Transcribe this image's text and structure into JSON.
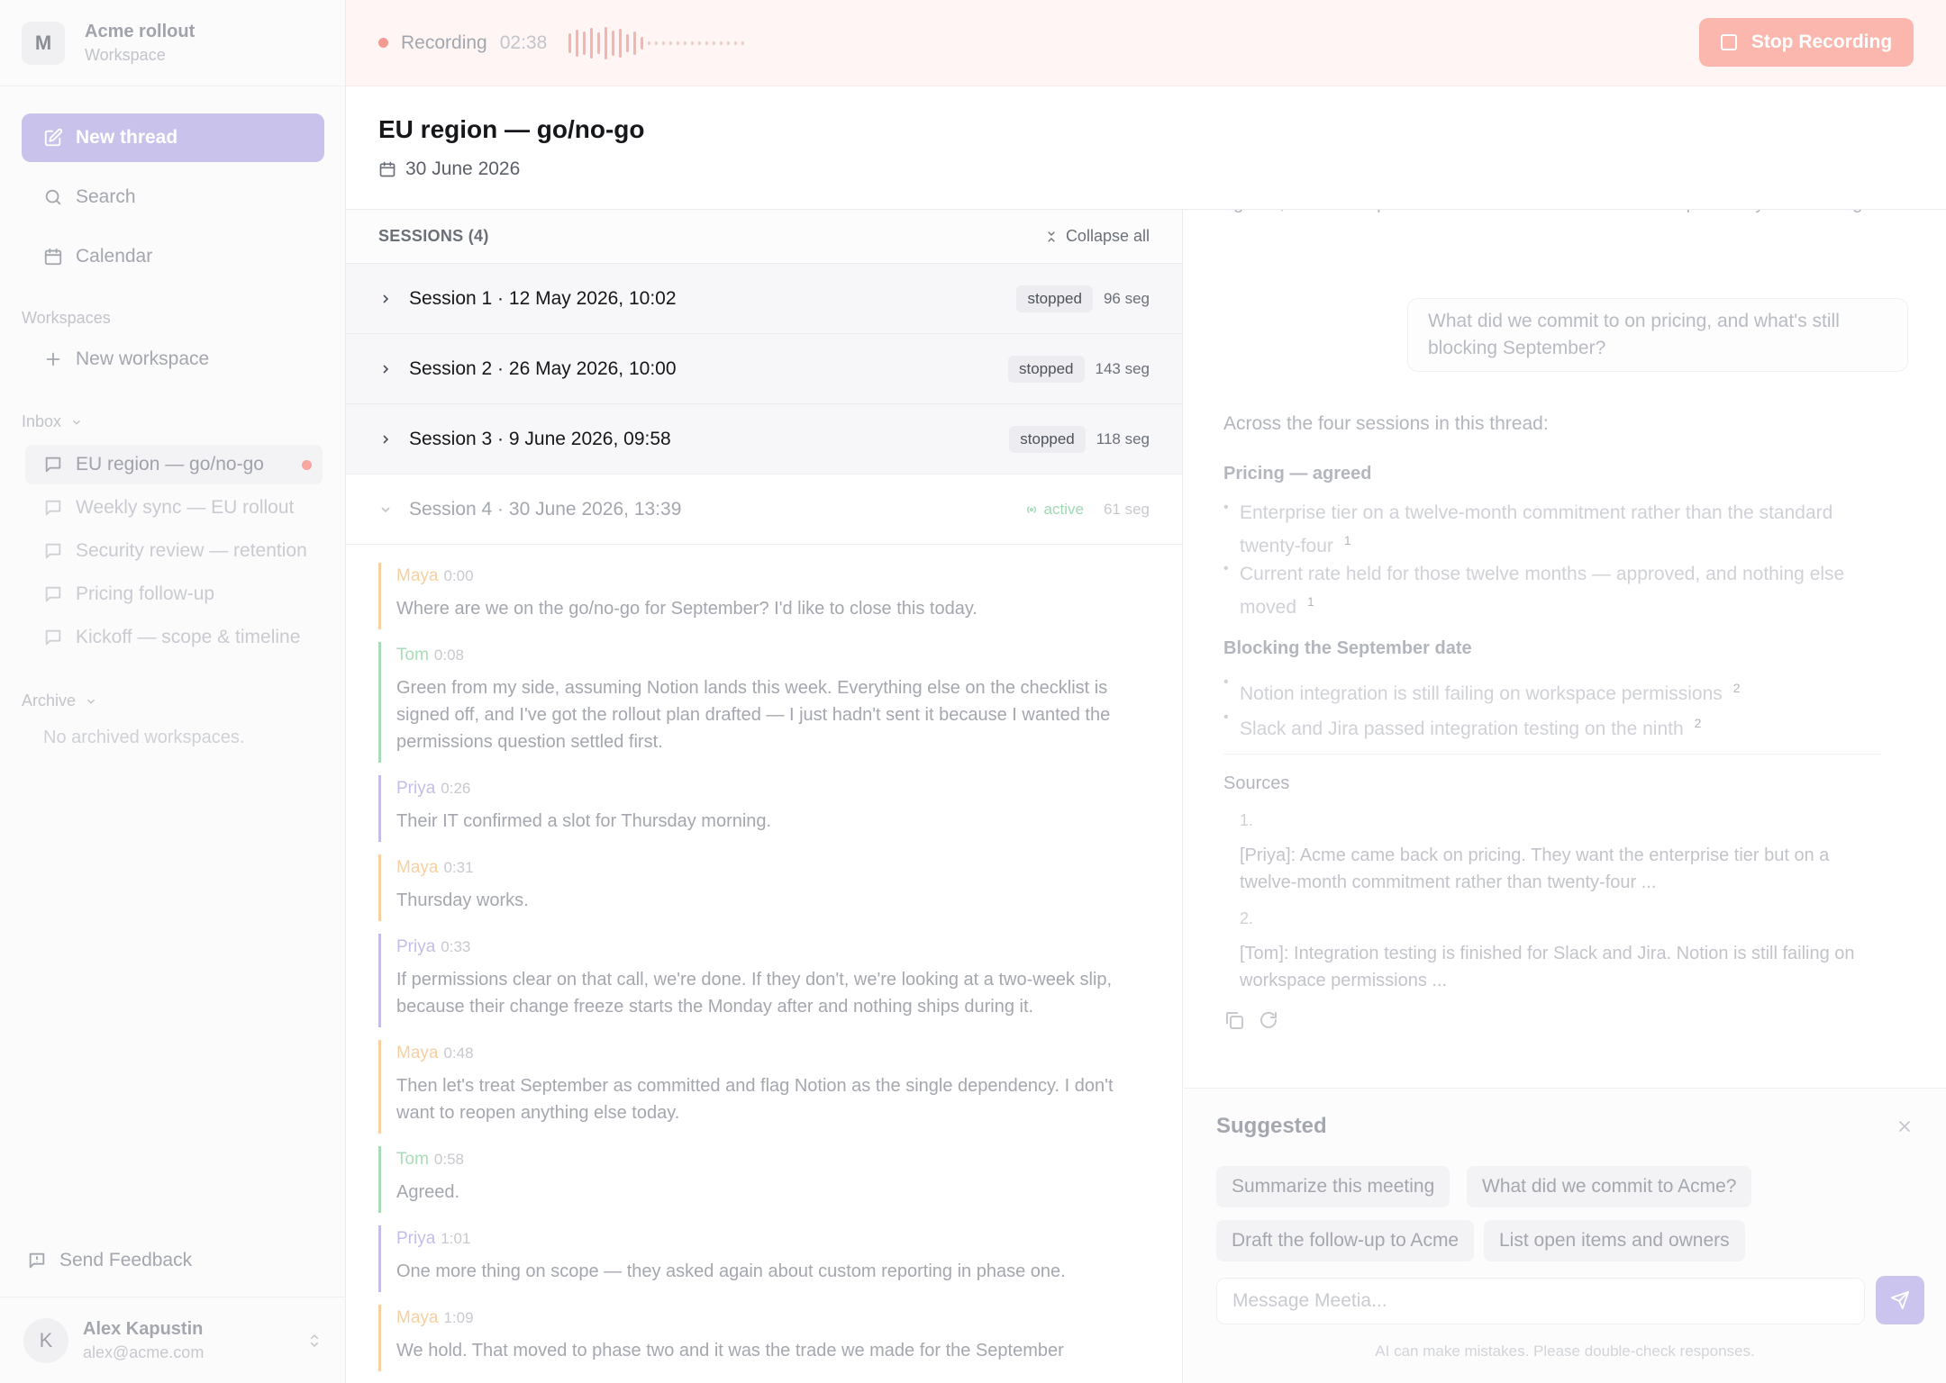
{
  "workspace": {
    "avatar_letter": "M",
    "name": "Acme rollout",
    "subtitle": "Workspace"
  },
  "sidebar": {
    "new_thread_label": "New thread",
    "search_label": "Search",
    "calendar_label": "Calendar",
    "workspaces_heading": "Workspaces",
    "new_workspace_label": "New workspace",
    "inbox_heading": "Inbox",
    "threads": [
      {
        "label": "EU region — go/no-go",
        "active": true,
        "unread": true
      },
      {
        "label": "Weekly sync — EU rollout"
      },
      {
        "label": "Security review — retention"
      },
      {
        "label": "Pricing follow-up"
      },
      {
        "label": "Kickoff — scope & timeline"
      }
    ],
    "archive_heading": "Archive",
    "archive_empty": "No archived workspaces.",
    "feedback_label": "Send Feedback",
    "user": {
      "initial": "K",
      "name": "Alex Kapustin",
      "email": "alex@acme.com"
    }
  },
  "recording": {
    "status_label": "Recording",
    "elapsed": "02:38",
    "stop_label": "Stop Recording",
    "accent_color": "#f29b93"
  },
  "thread": {
    "title": "EU region — go/no-go",
    "date": "30 June 2026"
  },
  "sessions": {
    "heading": "SESSIONS (4)",
    "collapse_label": "Collapse all",
    "items": [
      {
        "title": "Session 1 · 12 May 2026, 10:02",
        "status": "stopped",
        "segments": "96 seg"
      },
      {
        "title": "Session 2 · 26 May 2026, 10:00",
        "status": "stopped",
        "segments": "143 seg"
      },
      {
        "title": "Session 3 · 9 June 2026, 09:58",
        "status": "stopped",
        "segments": "118 seg"
      },
      {
        "title": "Session 4 · 30 June 2026, 13:39",
        "status": "active",
        "segments": "61 seg"
      }
    ]
  },
  "speaker_colors": {
    "Maya": "#f7cfa0",
    "Tom": "#a8dcb8",
    "Priya": "#c3bde8"
  },
  "transcript": [
    {
      "speaker": "Maya",
      "time": "0:00",
      "text": "Where are we on the go/no-go for September? I'd like to close this today."
    },
    {
      "speaker": "Tom",
      "time": "0:08",
      "text": "Green from my side, assuming Notion lands this week. Everything else on the checklist is signed off, and I've got the rollout plan drafted — I just hadn't sent it because I wanted the permissions question settled first."
    },
    {
      "speaker": "Priya",
      "time": "0:26",
      "text": "Their IT confirmed a slot for Thursday morning."
    },
    {
      "speaker": "Maya",
      "time": "0:31",
      "text": "Thursday works."
    },
    {
      "speaker": "Priya",
      "time": "0:33",
      "text": "If permissions clear on that call, we're done. If they don't, we're looking at a two-week slip, because their change freeze starts the Monday after and nothing ships during it."
    },
    {
      "speaker": "Maya",
      "time": "0:48",
      "text": "Then let's treat September as committed and flag Notion as the single dependency. I don't want to reopen anything else today."
    },
    {
      "speaker": "Tom",
      "time": "0:58",
      "text": "Agreed."
    },
    {
      "speaker": "Priya",
      "time": "1:01",
      "text": "One more thing on scope — they asked again about custom reporting in phase one."
    },
    {
      "speaker": "Maya",
      "time": "1:09",
      "text": "We hold. That moved to phase two and it was the trade we made for the September"
    }
  ],
  "chat": {
    "prev_answer_tail": "agreed, and the September date is committed with one dependency outstanding.",
    "user_question": "What did we commit to on pricing, and what's still blocking September?",
    "answer_intro": "Across the four sessions in this thread:",
    "sections": [
      {
        "heading": "Pricing — agreed",
        "bullets": [
          {
            "text": "Enterprise tier on a twelve-month commitment rather than the standard twenty-four",
            "cite": "1"
          },
          {
            "text": "Current rate held for those twelve months — approved, and nothing else moved",
            "cite": "1"
          }
        ]
      },
      {
        "heading": "Blocking the September date",
        "bullets": [
          {
            "text": "Notion integration is still failing on workspace permissions",
            "cite": "2"
          },
          {
            "text": "Slack and Jira passed integration testing on the ninth",
            "cite": "2"
          }
        ]
      }
    ],
    "sources_label": "Sources",
    "sources": [
      {
        "num": "1.",
        "text": "[Priya]: Acme came back on pricing. They want the enterprise tier but on a twelve-month commitment rather than twenty-four ..."
      },
      {
        "num": "2.",
        "text": "[Tom]: Integration testing is finished for Slack and Jira. Notion is still failing on workspace permissions ..."
      }
    ]
  },
  "suggested": {
    "title": "Suggested",
    "chips": [
      "Summarize this meeting",
      "What did we commit to Acme?",
      "Draft the follow-up to Acme",
      "List open items and owners"
    ],
    "input_placeholder": "Message Meetia...",
    "disclaimer": "AI can make mistakes. Please double-check responses."
  }
}
